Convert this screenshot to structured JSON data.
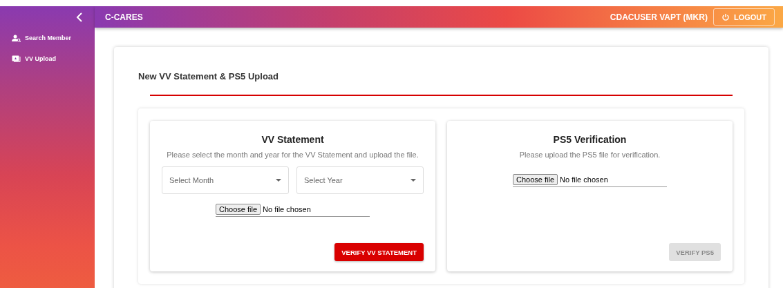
{
  "sidebar": {
    "items": [
      {
        "label": "Search Member"
      },
      {
        "label": "VV Upload"
      }
    ]
  },
  "header": {
    "title": "C-CARES",
    "user": "CDACUSER VAPT (MKR)",
    "logout": "LOGOUT"
  },
  "page": {
    "title": "New VV Statement & PS5 Upload",
    "cards": [
      {
        "kind": "statement",
        "title": "VV Statement",
        "description": "Please select the month and year for the VV Statement and upload the file.",
        "selects": [
          {
            "placeholder": "Select Month"
          },
          {
            "placeholder": "Select Year"
          }
        ],
        "file_button": "Choose file",
        "file_status": "No file chosen",
        "action": {
          "label": "VERIFY VV STATEMENT",
          "disabled": false
        }
      },
      {
        "kind": "verification",
        "title": "PS5 Verification",
        "description": "Please upload the PS5 file for verification.",
        "file_button": "Choose file",
        "file_status": "No file chosen",
        "action": {
          "label": "VERIFY PS5",
          "disabled": true
        }
      }
    ]
  }
}
